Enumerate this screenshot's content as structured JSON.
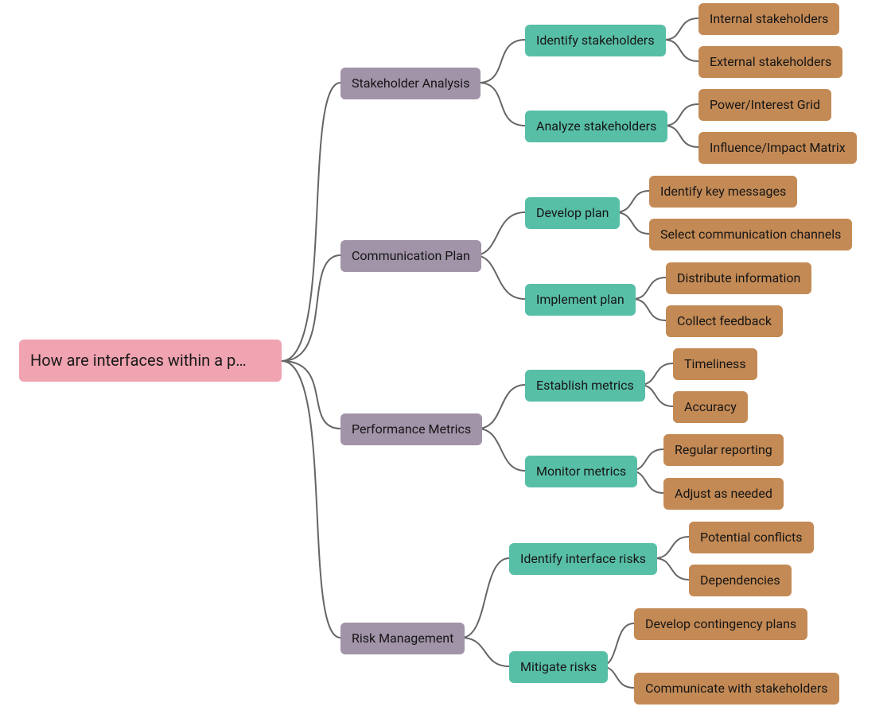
{
  "root": {
    "label": "How are interfaces within a p…"
  },
  "branches": [
    {
      "label": "Stakeholder Analysis",
      "children": [
        {
          "label": "Identify stakeholders",
          "children": [
            {
              "label": "Internal stakeholders"
            },
            {
              "label": "External stakeholders"
            }
          ]
        },
        {
          "label": "Analyze stakeholders",
          "children": [
            {
              "label": "Power/Interest Grid"
            },
            {
              "label": "Influence/Impact Matrix"
            }
          ]
        }
      ]
    },
    {
      "label": "Communication Plan",
      "children": [
        {
          "label": "Develop plan",
          "children": [
            {
              "label": "Identify key messages"
            },
            {
              "label": "Select communication channels"
            }
          ]
        },
        {
          "label": "Implement plan",
          "children": [
            {
              "label": "Distribute information"
            },
            {
              "label": "Collect feedback"
            }
          ]
        }
      ]
    },
    {
      "label": "Performance Metrics",
      "children": [
        {
          "label": "Establish metrics",
          "children": [
            {
              "label": "Timeliness"
            },
            {
              "label": "Accuracy"
            }
          ]
        },
        {
          "label": "Monitor metrics",
          "children": [
            {
              "label": "Regular reporting"
            },
            {
              "label": "Adjust as needed"
            }
          ]
        }
      ]
    },
    {
      "label": "Risk Management",
      "children": [
        {
          "label": "Identify interface risks",
          "children": [
            {
              "label": "Potential conflicts"
            },
            {
              "label": "Dependencies"
            }
          ]
        },
        {
          "label": "Mitigate risks",
          "children": [
            {
              "label": "Develop contingency plans"
            },
            {
              "label": "Communicate with stakeholders"
            }
          ]
        }
      ]
    }
  ]
}
